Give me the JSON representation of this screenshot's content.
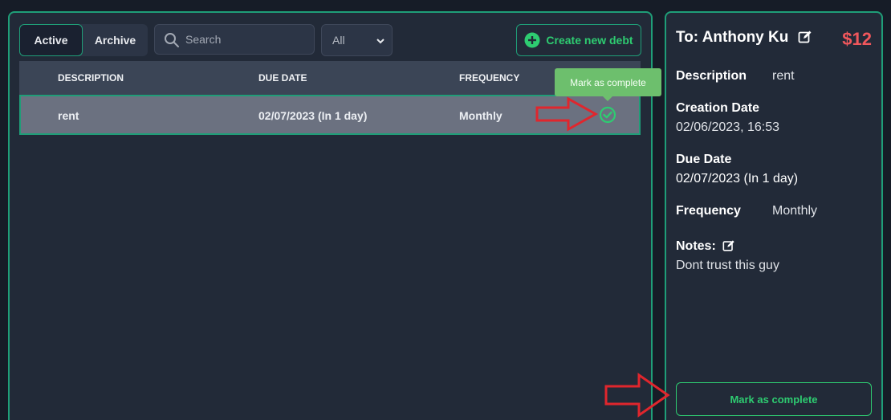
{
  "tabs": {
    "active": "Active",
    "archive": "Archive"
  },
  "search": {
    "placeholder": "Search"
  },
  "filter": {
    "selected": "All"
  },
  "create_button": "Create new debt",
  "table": {
    "headers": [
      "DESCRIPTION",
      "DUE DATE",
      "FREQUENCY"
    ],
    "rows": [
      {
        "description": "rent",
        "due_date": "02/07/2023 (In 1 day)",
        "frequency": "Monthly"
      }
    ]
  },
  "tooltip": "Mark as complete",
  "details": {
    "title": "To: Anthony Ku",
    "amount": "$12",
    "description_label": "Description",
    "description_value": "rent",
    "creation_label": "Creation Date",
    "creation_value": "02/06/2023, 16:53",
    "due_label": "Due Date",
    "due_value": "02/07/2023 (In 1 day)",
    "frequency_label": "Frequency",
    "frequency_value": "Monthly",
    "notes_label": "Notes:",
    "notes_value": "Dont trust this guy",
    "complete_button": "Mark as complete"
  },
  "colors": {
    "accent": "#1f9e78",
    "success": "#2ecc71",
    "amount": "#f0575c",
    "tooltip": "#6dbf6d",
    "annotation_arrow": "#e0262d"
  },
  "icons": [
    "search-icon",
    "chevron-down-icon",
    "plus-circle-icon",
    "check-circle-icon",
    "edit-icon",
    "red-arrow-icon"
  ]
}
